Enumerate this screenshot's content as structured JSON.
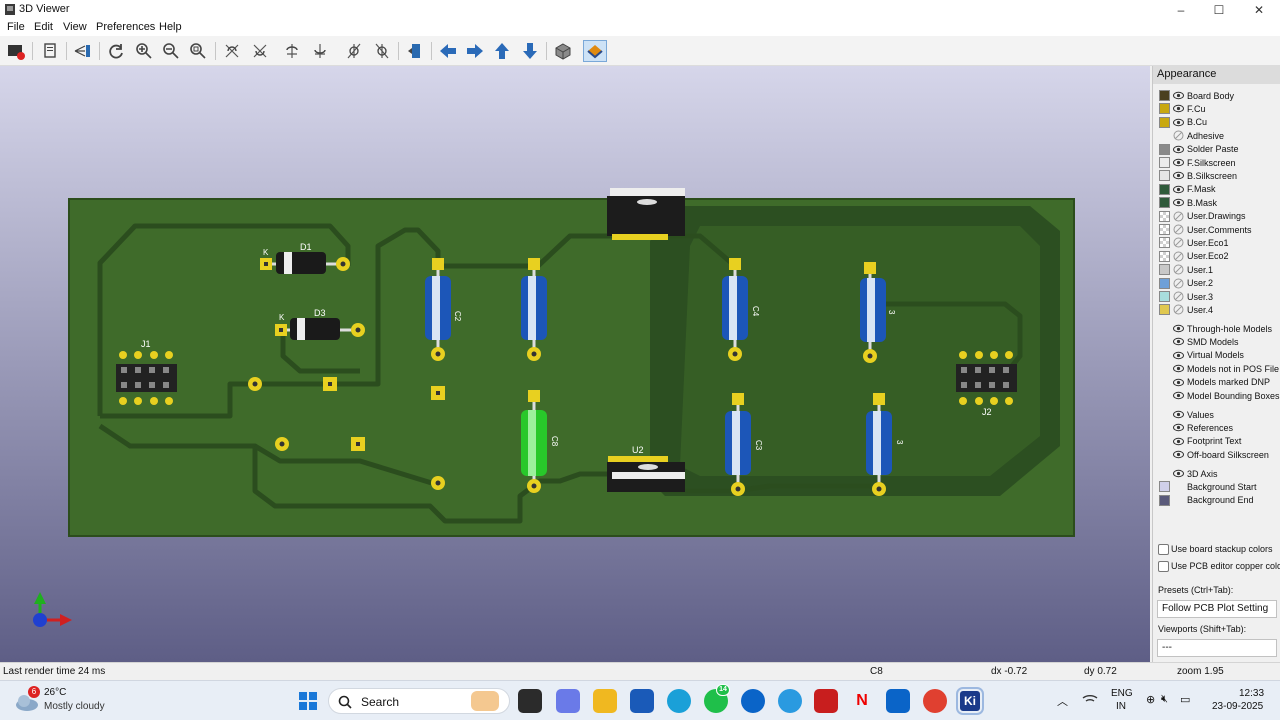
{
  "window": {
    "title": "3D Viewer",
    "minimize": "–",
    "maximize": "☐",
    "close": "✕"
  },
  "menu": [
    "File",
    "Edit",
    "View",
    "Preferences",
    "Help"
  ],
  "toolbar_icons": [
    "close-viewer-icon",
    "copy-image-icon",
    "raytrace-icon",
    "reload-icon",
    "zoom-in-icon",
    "zoom-out-icon",
    "zoom-fit-icon",
    "rotate-x-cw-icon",
    "rotate-x-ccw-icon",
    "rotate-y-cw-icon",
    "rotate-y-ccw-icon",
    "rotate-z-cw-icon",
    "rotate-z-ccw-icon",
    "flip-board-icon",
    "move-left-icon",
    "move-right-icon",
    "move-up-icon",
    "move-down-icon",
    "ortho-icon",
    "layers-toggle-icon"
  ],
  "board": {
    "refs": {
      "d1": "D1",
      "d3": "D3",
      "k1": "K",
      "k2": "K",
      "j1": "J1",
      "j2": "J2",
      "u2": "U2",
      "c2": "C2",
      "c4": "C4",
      "c3": "C3",
      "c8": "C8",
      "c9": "3",
      "c10": "3"
    },
    "colors": {
      "board": "#3f6b2a",
      "track": "#2f5522",
      "pad": "#e8d020",
      "cap_blue": "#1c56b8",
      "cap_green": "#28c82a",
      "diode": "#1a1a1a"
    }
  },
  "appearance": {
    "title": "Appearance",
    "layers": [
      {
        "name": "Board Body",
        "color": "#4a3f1f",
        "eye": true
      },
      {
        "name": "F.Cu",
        "color": "#c8a810",
        "eye": true
      },
      {
        "name": "B.Cu",
        "color": "#c8a810",
        "eye": true
      },
      {
        "name": "Adhesive",
        "color": "",
        "eye": false
      },
      {
        "name": "Solder Paste",
        "color": "#8a8a8a",
        "eye": true
      },
      {
        "name": "F.Silkscreen",
        "color": "#ececec",
        "eye": true
      },
      {
        "name": "B.Silkscreen",
        "color": "#e6e6e6",
        "eye": true
      },
      {
        "name": "F.Mask",
        "color": "#2f5a3a",
        "eye": true
      },
      {
        "name": "B.Mask",
        "color": "#2f5a3a",
        "eye": true
      },
      {
        "name": "User.Drawings",
        "color": "checker",
        "eye": false
      },
      {
        "name": "User.Comments",
        "color": "checker",
        "eye": false
      },
      {
        "name": "User.Eco1",
        "color": "checker",
        "eye": false
      },
      {
        "name": "User.Eco2",
        "color": "checker",
        "eye": false
      },
      {
        "name": "User.1",
        "color": "#c8c8c8",
        "eye": false
      },
      {
        "name": "User.2",
        "color": "#6ea0d8",
        "eye": false
      },
      {
        "name": "User.3",
        "color": "#a8dede",
        "eye": false
      },
      {
        "name": "User.4",
        "color": "#e0c850",
        "eye": false
      }
    ],
    "models": [
      {
        "name": "Through-hole Models"
      },
      {
        "name": "SMD Models"
      },
      {
        "name": "Virtual Models"
      },
      {
        "name": "Models not in POS File"
      },
      {
        "name": "Models marked DNP"
      },
      {
        "name": "Model Bounding Boxes"
      }
    ],
    "misc": [
      {
        "name": "Values"
      },
      {
        "name": "References"
      },
      {
        "name": "Footprint Text"
      },
      {
        "name": "Off-board Silkscreen"
      }
    ],
    "axis": [
      {
        "name": "3D Axis",
        "color": ""
      },
      {
        "name": "Background Start",
        "color": "#d0d0ea"
      },
      {
        "name": "Background End",
        "color": "#5a5a7a"
      }
    ],
    "use_board_stackup": "Use board stackup colors",
    "use_pcb_copper": "Use PCB editor copper colo",
    "presets_label": "Presets (Ctrl+Tab):",
    "presets_value": "Follow PCB Plot Setting",
    "viewports_label": "Viewports (Shift+Tab):",
    "viewports_value": "---"
  },
  "status": {
    "render": "Last render time 24 ms",
    "selected": "C8",
    "dx": "dx -0.72",
    "dy": "dy 0.72",
    "zoom": "zoom 1.95"
  },
  "taskbar": {
    "weather_temp": "26°C",
    "weather_desc": "Mostly cloudy",
    "weather_badge": "6",
    "search": "Search",
    "whatsapp_badge": "14",
    "lang": "ENG",
    "lang_region": "IN",
    "time": "12:33",
    "date": "23-09-2025"
  }
}
